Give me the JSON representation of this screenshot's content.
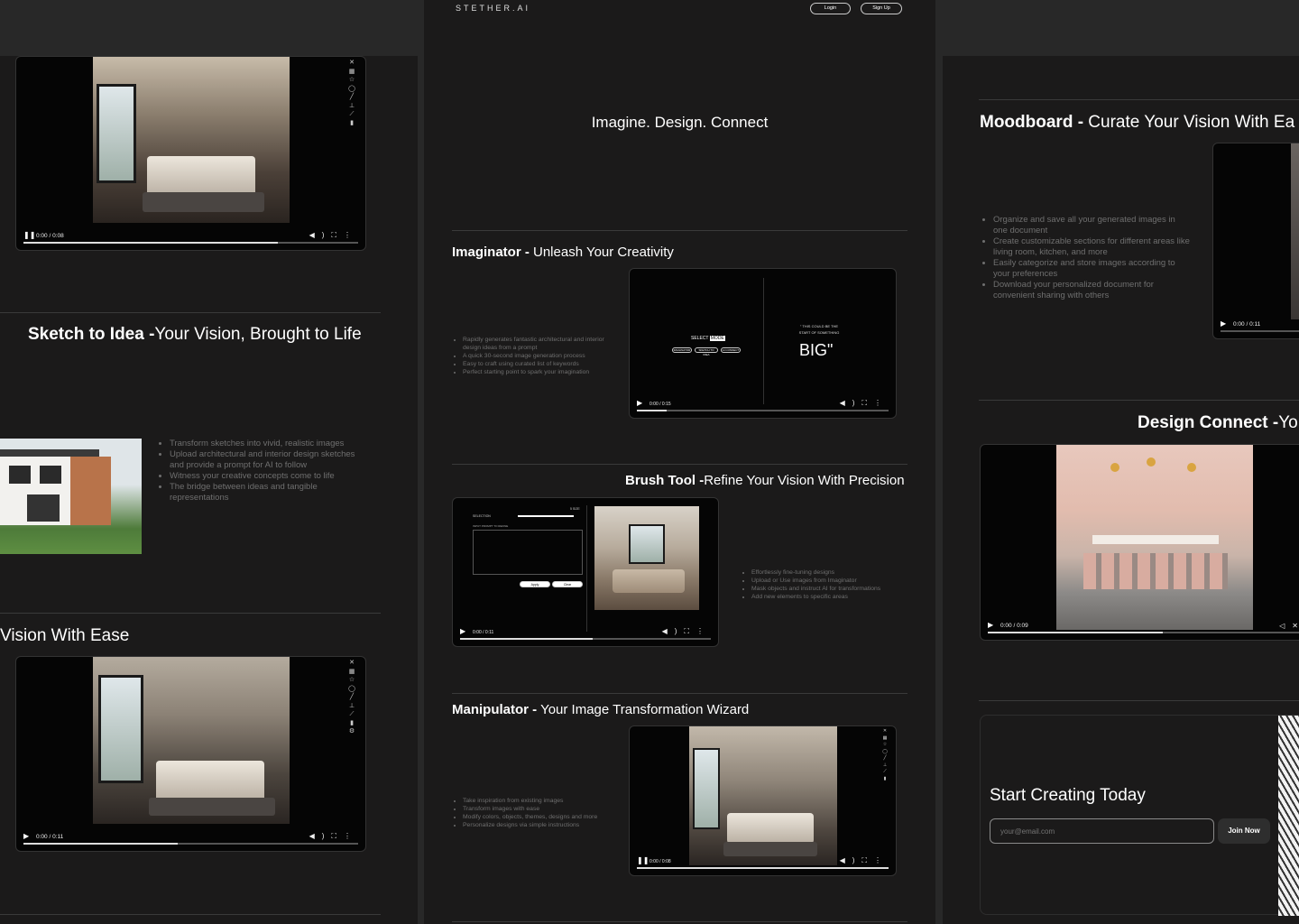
{
  "header": {
    "logo": "STETHER.AI",
    "login_label": "Login",
    "signup_label": "Sign Up"
  },
  "hero": {
    "tagline": "Imagine. Design. Connect"
  },
  "imaginator": {
    "title_bold": "Imaginator -",
    "title_rest": " Unleash Your Creativity",
    "bullets": [
      "Rapidly generates fantastic architectural and interior design ideas from a prompt",
      "A quick 30-second image generation process",
      "Easy to craft using curated list of keywords",
      "Perfect starting point to spark your imagination"
    ],
    "video": {
      "time": "0:00 / 0:15",
      "select_label": "SELECT",
      "mode_label": "MODE",
      "mode_buttons": [
        "IMAGINATOR",
        "SKETCH TO IDEA",
        "AI CONNECT"
      ],
      "quote_small": "\" THIS COULD BE THE START OF SOMETHING",
      "quote_big": "BIG\"",
      "progress": 0.12
    }
  },
  "brush": {
    "title_bold": "Brush Tool -",
    "title_rest": "Refine Your Vision With Precision",
    "bullets": [
      "Effortlessly fine-tuning designs",
      "Upload or Use images from Imaginator",
      "Mask objects and instruct AI for transformations",
      "Add new elements to specific areas"
    ],
    "video": {
      "time": "0:00 / 0:11",
      "size_label": "5 SIZE",
      "selection_label": "SELECTION",
      "prompt_label": "INPUT PROMPT TO REFINE",
      "apply_label": "Apply",
      "clear_label": "Clear",
      "progress": 0.53
    }
  },
  "manipulator": {
    "title_bold": "Manipulator -",
    "title_rest": " Your Image Transformation Wizard",
    "bullets": [
      "Take inspiration from existing images",
      "Transform images with ease",
      "Modify colors, objects, themes, designs and more",
      "Personalize designs via simple instructions"
    ],
    "video": {
      "time": "0:00 / 0:08",
      "progress": 1.0
    }
  },
  "sketch": {
    "title_bold": "Sketch to Idea -",
    "title_rest": "Your Vision, Brought to Life",
    "bullets": [
      "Transform sketches into vivid, realistic images",
      "Upload architectural and interior design sketches and provide a prompt for AI to follow",
      "Witness your creative concepts come to life",
      "The bridge between ideas and tangible representations"
    ]
  },
  "left": {
    "video_top_time": "0:00 / 0:08",
    "video_top_progress": 0.76,
    "partial_title": "Vision With Ease",
    "video_bottom_time": "0:00 / 0:11",
    "video_bottom_progress": 0.46
  },
  "moodboard": {
    "title_bold": "Moodboard -",
    "title_rest": " Curate Your Vision With Ea",
    "bullets": [
      "Organize and save all your generated images in one document",
      "Create customizable sections for different areas like living room, kitchen, and more",
      "Easily categorize and store images according to your preferences",
      "Download your personalized document for convenient sharing with others"
    ],
    "video_time": "0:00 / 0:11"
  },
  "design_connect": {
    "title_bold": "Design Connect -",
    "title_rest": "Yo",
    "video_time": "0:00 / 0:09",
    "progress": 0.55
  },
  "cta": {
    "title": "Start Creating Today",
    "email_placeholder": "your@email.com",
    "join_label": "Join Now"
  }
}
